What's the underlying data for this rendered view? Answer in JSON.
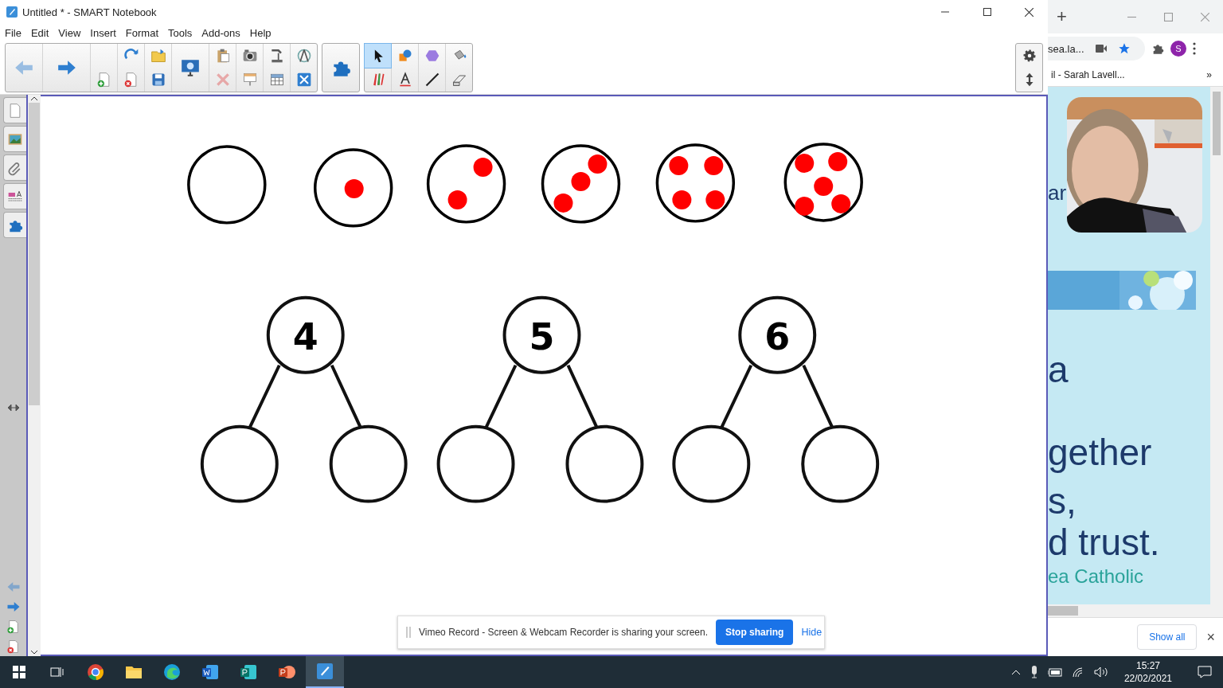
{
  "window": {
    "title": "Untitled * - SMART Notebook"
  },
  "menu": [
    "File",
    "Edit",
    "View",
    "Insert",
    "Format",
    "Tools",
    "Add-ons",
    "Help"
  ],
  "toolbar": {
    "groups": [
      {
        "columns": [
          [
            {
              "kind": "back",
              "disabled": true
            }
          ],
          [
            {
              "kind": "forward",
              "disabled": false
            }
          ],
          [
            {
              "kind": "new-page",
              "disabled": false
            }
          ],
          [
            {
              "kind": "redo",
              "disabled": false
            },
            {
              "kind": "delete-page",
              "disabled": false
            }
          ],
          [
            {
              "kind": "open",
              "disabled": false
            },
            {
              "kind": "save",
              "disabled": false
            }
          ],
          [
            {
              "kind": "display",
              "disabled": false
            }
          ],
          [
            {
              "kind": "paste",
              "disabled": false
            },
            {
              "kind": "delete",
              "disabled": true
            }
          ],
          [
            {
              "kind": "camera",
              "disabled": false
            },
            {
              "kind": "screen-shade",
              "disabled": false
            }
          ],
          [
            {
              "kind": "doc-camera",
              "disabled": false
            },
            {
              "kind": "table",
              "disabled": false
            }
          ],
          [
            {
              "kind": "measure",
              "disabled": false
            },
            {
              "kind": "fullscreen",
              "disabled": false
            }
          ]
        ]
      },
      {
        "columns": [
          [
            {
              "kind": "addons",
              "disabled": false
            }
          ]
        ]
      },
      {
        "columns": [
          [
            {
              "kind": "select",
              "selected": true
            },
            {
              "kind": "pens",
              "selected": false
            }
          ],
          [
            {
              "kind": "shapes",
              "selected": false
            },
            {
              "kind": "text",
              "selected": false
            }
          ],
          [
            {
              "kind": "magic-pen",
              "selected": false
            },
            {
              "kind": "line",
              "selected": false
            }
          ],
          [
            {
              "kind": "fill",
              "selected": false
            },
            {
              "kind": "eraser",
              "selected": false
            }
          ]
        ]
      }
    ]
  },
  "side_tabs": [
    {
      "kind": "page-sorter"
    },
    {
      "kind": "gallery"
    },
    {
      "kind": "attachments"
    },
    {
      "kind": "properties"
    },
    {
      "kind": "addons"
    }
  ],
  "page_nav": [
    {
      "kind": "back",
      "disabled": true
    },
    {
      "kind": "forward",
      "disabled": false
    },
    {
      "kind": "new-page",
      "disabled": false
    },
    {
      "kind": "delete-page",
      "disabled": false
    }
  ],
  "number_bonds": [
    {
      "whole": "4"
    },
    {
      "whole": "5"
    },
    {
      "whole": "6"
    }
  ],
  "share_bar": {
    "message": "Vimeo Record - Screen & Webcam Recorder is sharing your screen.",
    "stop_button": "Stop sharing",
    "hide_link": "Hide"
  },
  "browser": {
    "new_tab": "+",
    "address": "sea.la...",
    "avatar": "S",
    "bookmark": "il - Sarah Lavell...",
    "bookmarks_more": "»",
    "page_texts": [
      {
        "kind": "heading",
        "text": "ar"
      },
      {
        "kind": "large",
        "text": "a"
      },
      {
        "kind": "large",
        "text": "gether"
      },
      {
        "kind": "large",
        "text": "s,"
      },
      {
        "kind": "large",
        "text": "d trust."
      },
      {
        "kind": "teal",
        "text": "ea Catholic"
      }
    ],
    "downloads_button": "Show all",
    "close_downloads": "×"
  },
  "taskbar": {
    "apps": [
      {
        "kind": "chrome",
        "active": false
      },
      {
        "kind": "explorer",
        "active": false
      },
      {
        "kind": "edge",
        "active": false
      },
      {
        "kind": "word",
        "active": false
      },
      {
        "kind": "publisher",
        "active": false
      },
      {
        "kind": "powerpoint",
        "active": false
      },
      {
        "kind": "notebook",
        "active": true
      }
    ],
    "time": "15:27",
    "date": "22/02/2021"
  }
}
